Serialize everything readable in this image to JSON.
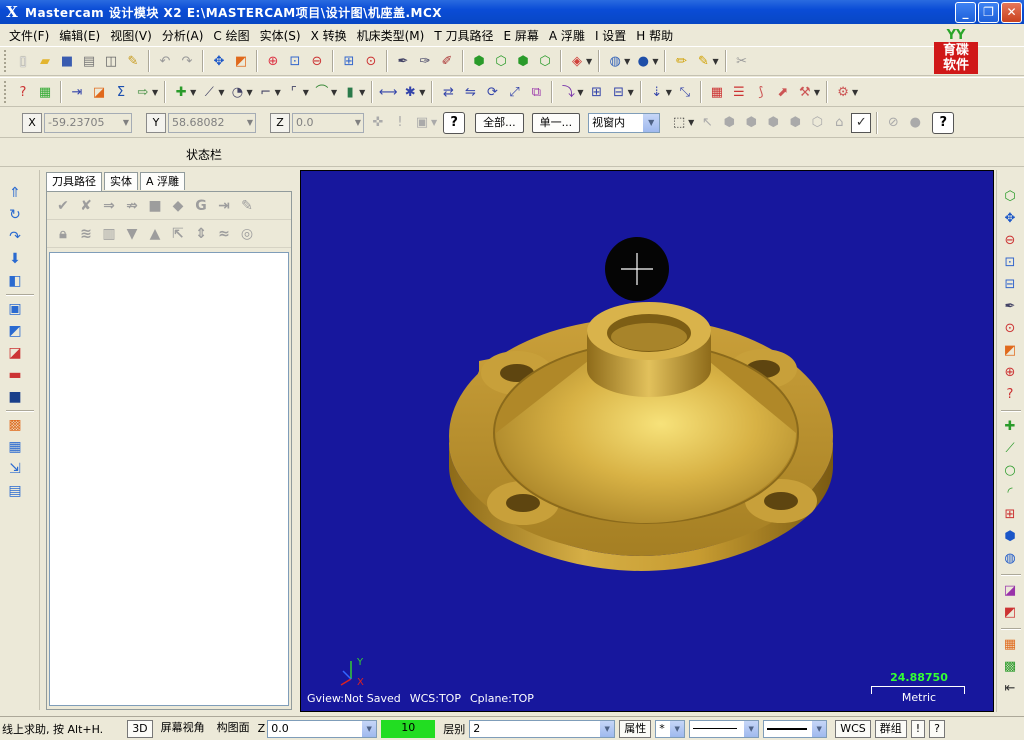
{
  "window": {
    "app_icon": "X",
    "title": "Mastercam 设计模块  X2  E:\\MASTERCAM项目\\设计图\\机座盖.MCX",
    "buttons": {
      "minimize": "_",
      "maximize": "❐",
      "close": "✕"
    }
  },
  "menu": [
    "文件(F)",
    "编辑(E)",
    "视图(V)",
    "分析(A)",
    "C 绘图",
    "实体(S)",
    "X 转换",
    "机床类型(M)",
    "T 刀具路径",
    "E 屏幕",
    "A 浮雕",
    "I 设置",
    "H 帮助"
  ],
  "logo": {
    "top": "YY",
    "text": "育碟\n软件"
  },
  "coordinates": {
    "x_label": "X",
    "x_value": "-59.23705",
    "y_label": "Y",
    "y_value": "58.68082",
    "z_label": "Z",
    "z_value": "0.0"
  },
  "selection": {
    "all_button": "全部...",
    "single_button": "单一...",
    "scope_value": "视窗内",
    "help": "?"
  },
  "status_label": "状态栏",
  "ops_manager": {
    "tabs": [
      "刀具路径",
      "实体",
      "A 浮雕"
    ]
  },
  "viewport": {
    "gview": "Gview:Not Saved",
    "wcs": "WCS:TOP",
    "cplane": "Cplane:TOP",
    "axis_x": "X",
    "axis_y": "Y",
    "scale_value": "24.88750",
    "scale_unit": "Metric"
  },
  "bottom": {
    "prompt": "线上求助, 按 Alt+H.",
    "view3d": "3D",
    "screen_view": "屏幕视角",
    "cplane_btn": "构图面",
    "z_label": "Z",
    "z_value": "0.0",
    "color_value": "10",
    "level_label": "层别",
    "level_value": "2",
    "attributes": "属性",
    "point_style": "*",
    "wcs_btn": "WCS",
    "group_btn": "群组",
    "help_btn": "!",
    "question_btn": "?"
  },
  "colors": {
    "viewport_bg": "#17179d",
    "part_gold": "#c9a13a",
    "title_bar": "#0a4cd6",
    "level_green": "#22dd22"
  }
}
